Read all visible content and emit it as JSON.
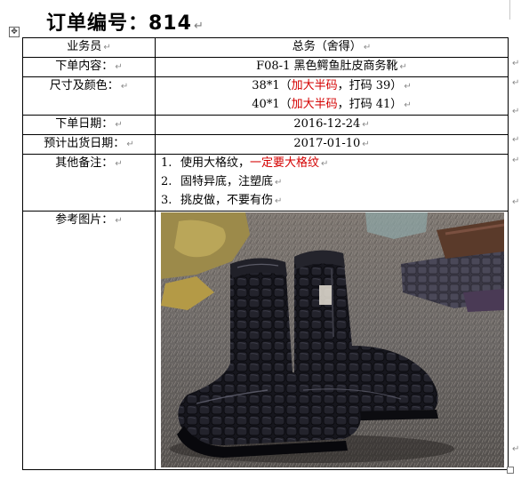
{
  "title": "订单编号：814",
  "mark": "↵",
  "rows": {
    "salesman": {
      "label": "业务员",
      "value": "总务（舍得）"
    },
    "content": {
      "label": "下单内容：",
      "value": "F08-1 黑色鳄鱼肚皮商务靴"
    },
    "size": {
      "label": "尺寸及颜色：",
      "line1": {
        "a": "38*1（",
        "red": "加大半码",
        "b": "，打码 39）"
      },
      "line2": {
        "a": "40*1（",
        "red": "加大半码",
        "b": "，打码 41）"
      }
    },
    "order_date": {
      "label": "下单日期：",
      "value": "2016-12-24"
    },
    "ship_date": {
      "label": "预计出货日期：",
      "value": "2017-01-10"
    },
    "notes": {
      "label": "其他备注：",
      "items": [
        {
          "num": "1.",
          "text": "使用大格纹，",
          "red": "一定要大格纹"
        },
        {
          "num": "2.",
          "text": "固特异底，注塑底"
        },
        {
          "num": "3.",
          "text": "挑皮做，不要有伤"
        }
      ]
    },
    "photo": {
      "label": "参考图片："
    }
  },
  "colors": {
    "accent": "#d40000",
    "marks": "#8a8a8a"
  }
}
